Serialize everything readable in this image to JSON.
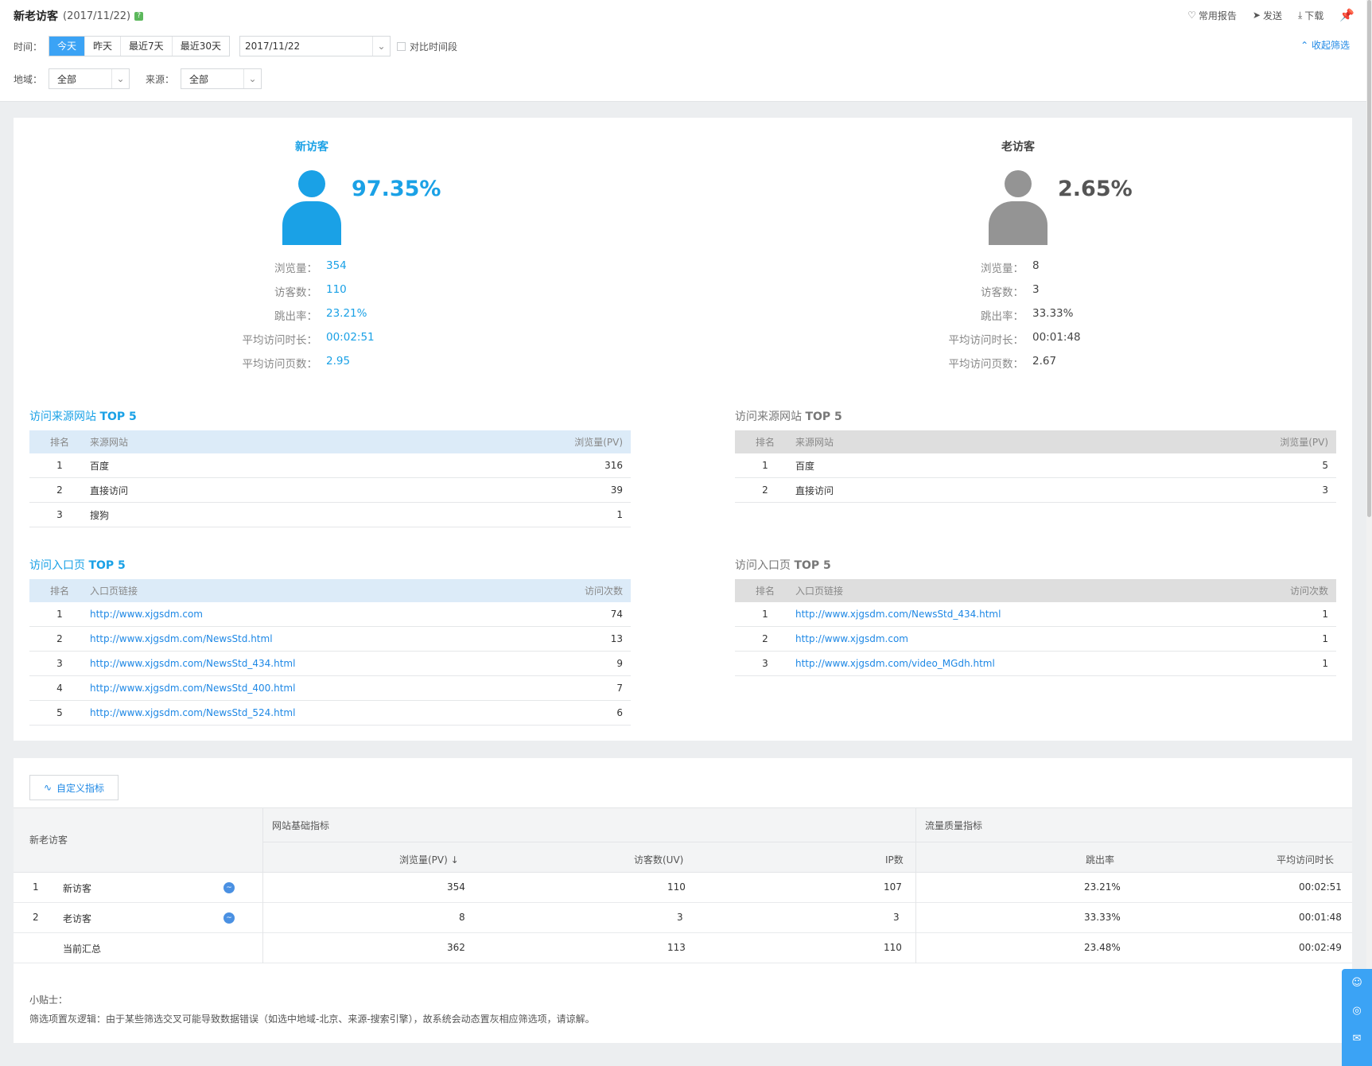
{
  "header": {
    "title": "新老访客",
    "date": "(2017/11/22)",
    "help": "?",
    "actions": {
      "favorite": "常用报告",
      "send": "发送",
      "download": "下载"
    }
  },
  "filters": {
    "time_label": "时间：",
    "time_options": [
      "今天",
      "昨天",
      "最近7天",
      "最近30天"
    ],
    "active_time": "今天",
    "date_value": "2017/11/22",
    "compare_label": "对比时间段",
    "region_label": "地域：",
    "region_value": "全部",
    "source_label": "来源：",
    "source_value": "全部",
    "collapse_label": "收起筛选"
  },
  "new_visitor": {
    "title": "新访客",
    "percent": "97.35%",
    "stats": [
      {
        "label": "浏览量：",
        "value": "354"
      },
      {
        "label": "访客数：",
        "value": "110"
      },
      {
        "label": "跳出率：",
        "value": "23.21%"
      },
      {
        "label": "平均访问时长：",
        "value": "00:02:51"
      },
      {
        "label": "平均访问页数：",
        "value": "2.95"
      }
    ],
    "source_title": "访问来源网站",
    "source_top": "TOP 5",
    "source_headers": [
      "排名",
      "来源网站",
      "浏览量(PV)"
    ],
    "sources": [
      {
        "rank": "1",
        "name": "百度",
        "value": "316"
      },
      {
        "rank": "2",
        "name": "直接访问",
        "value": "39"
      },
      {
        "rank": "3",
        "name": "搜狗",
        "value": "1"
      }
    ],
    "entry_title": "访问入口页",
    "entry_top": "TOP 5",
    "entry_headers": [
      "排名",
      "入口页链接",
      "访问次数"
    ],
    "entries": [
      {
        "rank": "1",
        "url": "http://www.xjgsdm.com",
        "value": "74"
      },
      {
        "rank": "2",
        "url": "http://www.xjgsdm.com/NewsStd.html",
        "value": "13"
      },
      {
        "rank": "3",
        "url": "http://www.xjgsdm.com/NewsStd_434.html",
        "value": "9"
      },
      {
        "rank": "4",
        "url": "http://www.xjgsdm.com/NewsStd_400.html",
        "value": "7"
      },
      {
        "rank": "5",
        "url": "http://www.xjgsdm.com/NewsStd_524.html",
        "value": "6"
      }
    ]
  },
  "old_visitor": {
    "title": "老访客",
    "percent": "2.65%",
    "stats": [
      {
        "label": "浏览量：",
        "value": "8"
      },
      {
        "label": "访客数：",
        "value": "3"
      },
      {
        "label": "跳出率：",
        "value": "33.33%"
      },
      {
        "label": "平均访问时长：",
        "value": "00:01:48"
      },
      {
        "label": "平均访问页数：",
        "value": "2.67"
      }
    ],
    "source_title": "访问来源网站",
    "source_top": "TOP 5",
    "source_headers": [
      "排名",
      "来源网站",
      "浏览量(PV)"
    ],
    "sources": [
      {
        "rank": "1",
        "name": "百度",
        "value": "5"
      },
      {
        "rank": "2",
        "name": "直接访问",
        "value": "3"
      }
    ],
    "entry_title": "访问入口页",
    "entry_top": "TOP 5",
    "entry_headers": [
      "排名",
      "入口页链接",
      "访问次数"
    ],
    "entries": [
      {
        "rank": "1",
        "url": "http://www.xjgsdm.com/NewsStd_434.html",
        "value": "1"
      },
      {
        "rank": "2",
        "url": "http://www.xjgsdm.com",
        "value": "1"
      },
      {
        "rank": "3",
        "url": "http://www.xjgsdm.com/video_MGdh.html",
        "value": "1"
      }
    ]
  },
  "metrics": {
    "custom_button": "自定义指标",
    "row_header": "新老访客",
    "group_basic": "网站基础指标",
    "group_quality": "流量质量指标",
    "columns": [
      "浏览量(PV)",
      "访客数(UV)",
      "IP数",
      "跳出率",
      "平均访问时长"
    ],
    "sort_indicator": "↓",
    "rows": [
      {
        "rank": "1",
        "name": "新访客",
        "pv": "354",
        "uv": "110",
        "ip": "107",
        "bounce": "23.21%",
        "duration": "00:02:51"
      },
      {
        "rank": "2",
        "name": "老访客",
        "pv": "8",
        "uv": "3",
        "ip": "3",
        "bounce": "33.33%",
        "duration": "00:01:48"
      },
      {
        "rank": "",
        "name": "当前汇总",
        "pv": "362",
        "uv": "113",
        "ip": "110",
        "bounce": "23.48%",
        "duration": "00:02:49"
      }
    ]
  },
  "tips": {
    "title": "小贴士：",
    "text": "筛选项置灰逻辑：由于某些筛选交叉可能导致数据错误（如选中地域-北京、来源-搜索引擎），故系统会动态置灰相应筛选项，请谅解。"
  },
  "colors": {
    "accent": "#1aa1e6",
    "old": "#949494",
    "button_active": "#3ba3f5"
  }
}
